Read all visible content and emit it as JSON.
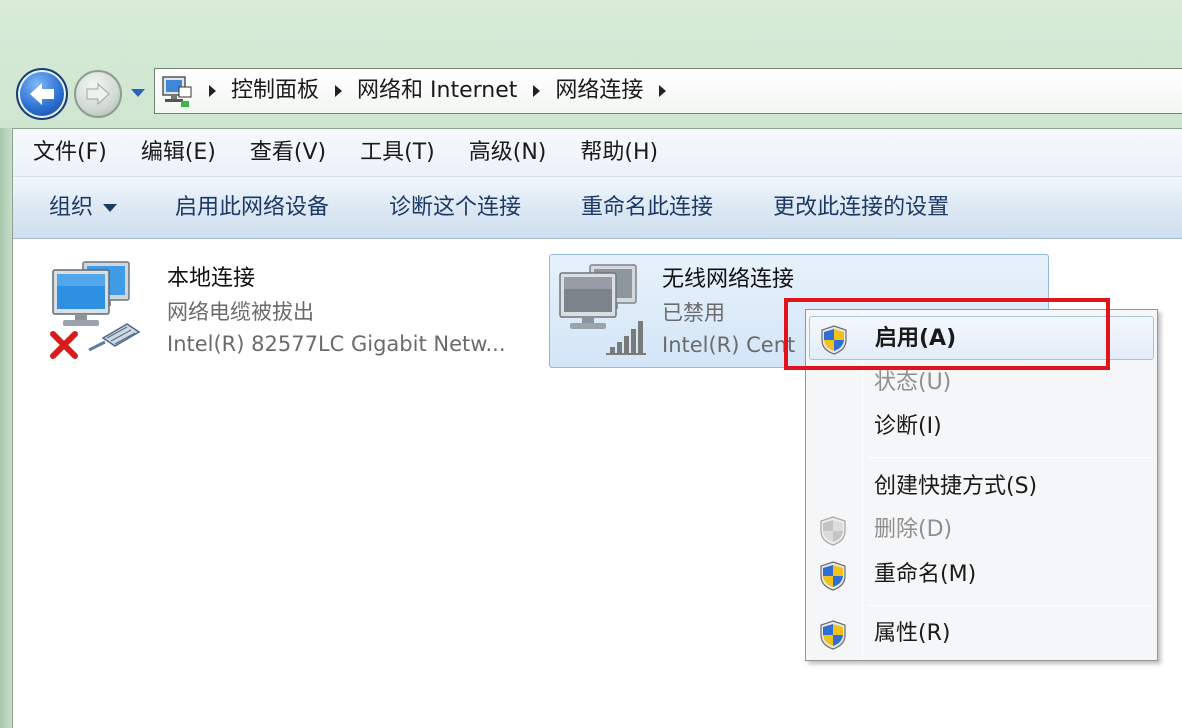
{
  "breadcrumb": [
    "控制面板",
    "网络和 Internet",
    "网络连接"
  ],
  "menubar": [
    "文件(F)",
    "编辑(E)",
    "查看(V)",
    "工具(T)",
    "高级(N)",
    "帮助(H)"
  ],
  "toolbar": {
    "organize": "组织",
    "enable_device": "启用此网络设备",
    "diagnose": "诊断这个连接",
    "rename": "重命名此连接",
    "change_settings": "更改此连接的设置"
  },
  "connections": [
    {
      "name": "本地连接",
      "status": "网络电缆被拔出",
      "device": "Intel(R) 82577LC Gigabit Netw...",
      "icon": "wired-network-disconnected-icon"
    },
    {
      "name": "无线网络连接",
      "status": "已禁用",
      "device": "Intel(R) Cent",
      "icon": "wireless-network-disabled-icon",
      "selected": true
    }
  ],
  "context_menu": [
    {
      "label": "启用(A)",
      "shield": true,
      "bold": true,
      "hover": true,
      "disabled": false
    },
    {
      "label": "状态(U)",
      "shield": false,
      "disabled": true
    },
    {
      "label": "诊断(I)",
      "shield": false,
      "disabled": false
    },
    {
      "label": "创建快捷方式(S)",
      "shield": false,
      "disabled": false
    },
    {
      "label": "删除(D)",
      "shield": true,
      "disabled": true
    },
    {
      "label": "重命名(M)",
      "shield": true,
      "disabled": false
    },
    {
      "label": "属性(R)",
      "shield": true,
      "disabled": false
    }
  ],
  "colors": {
    "highlight_box": "#e0141a",
    "selection_fill": "#d3e5f7",
    "command_text": "#1b3a66"
  }
}
